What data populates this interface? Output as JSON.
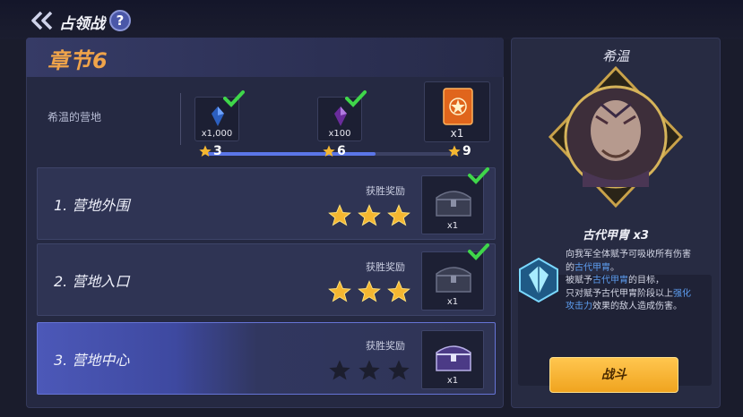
{
  "header": {
    "title": "占领战",
    "help_label": "?"
  },
  "chapter": {
    "title": "章节6"
  },
  "progress": {
    "camp_label": "希温的营地",
    "rewards": [
      {
        "icon": "blue-crystal-icon",
        "count": "x1,000",
        "claimed": true
      },
      {
        "icon": "purple-crystal-icon",
        "count": "x100",
        "claimed": true
      },
      {
        "icon": "orange-card-icon",
        "count": "x1",
        "claimed": false
      }
    ],
    "milestones": [
      "3",
      "6",
      "9"
    ],
    "filled_fraction": 0.67
  },
  "stages": [
    {
      "name": "1. 营地外围",
      "win_label": "获胜奖励",
      "stars": 3,
      "reward_count": "x1",
      "claimed": true
    },
    {
      "name": "2. 营地入口",
      "win_label": "获胜奖励",
      "stars": 3,
      "reward_count": "x1",
      "claimed": true
    },
    {
      "name": "3. 营地中心",
      "win_label": "获胜奖励",
      "stars": 0,
      "reward_count": "x1",
      "claimed": false
    }
  ],
  "boss": {
    "name": "希温",
    "buff_title": "古代甲胄 x3",
    "buff_desc": {
      "l1": "向我军全体赋予可吸收所有伤害",
      "l2a": "的",
      "l2b": "古代甲胄",
      "l2c": "。",
      "l3a": "被赋予",
      "l3b": "古代甲胄",
      "l3c": "的目标，",
      "l4a": "只对赋予古代甲胄阶段以上",
      "l4b": "强化",
      "l5a": "攻击力",
      "l5b": "效果的敌人造成伤害。"
    }
  },
  "fight_label": "战斗",
  "colors": {
    "accent": "#f0a44a",
    "highlight": "#5d9df0",
    "check": "#3fd64a",
    "star": "#f5b731"
  }
}
